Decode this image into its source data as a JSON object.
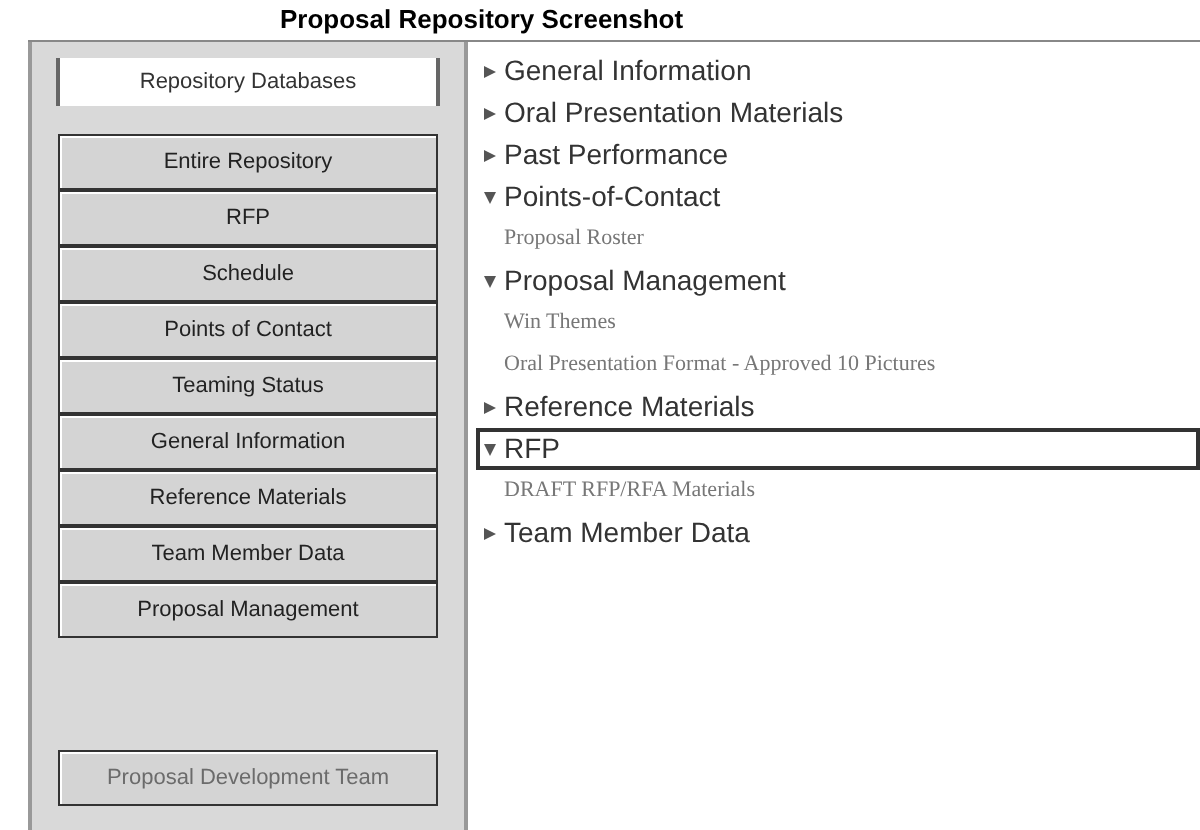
{
  "window": {
    "title": "Proposal Repository Screenshot"
  },
  "sidebar": {
    "header": "Repository Databases",
    "buttons": [
      {
        "label": "Entire Repository",
        "disabled": false
      },
      {
        "label": "RFP",
        "disabled": false
      },
      {
        "label": "Schedule",
        "disabled": false
      },
      {
        "label": "Points of Contact",
        "disabled": false
      },
      {
        "label": "Teaming Status",
        "disabled": false
      },
      {
        "label": "General Information",
        "disabled": false
      },
      {
        "label": "Reference Materials",
        "disabled": false
      },
      {
        "label": "Team Member Data",
        "disabled": false
      },
      {
        "label": "Proposal Management",
        "disabled": false
      }
    ],
    "footer_button": {
      "label": "Proposal Development Team",
      "disabled": true
    }
  },
  "tree": [
    {
      "label": "General Information",
      "expanded": false,
      "selected": false
    },
    {
      "label": "Oral Presentation Materials",
      "expanded": false,
      "selected": false
    },
    {
      "label": "Past Performance",
      "expanded": false,
      "selected": false
    },
    {
      "label": "Points-of-Contact",
      "expanded": true,
      "selected": false,
      "children": [
        {
          "label": "Proposal Roster"
        }
      ]
    },
    {
      "label": "Proposal Management",
      "expanded": true,
      "selected": false,
      "children": [
        {
          "label": "Win Themes"
        },
        {
          "label": "Oral Presentation Format - Approved 10 Pictures"
        }
      ]
    },
    {
      "label": "Reference Materials",
      "expanded": false,
      "selected": false
    },
    {
      "label": "RFP",
      "expanded": true,
      "selected": true,
      "children": [
        {
          "label": "DRAFT RFP/RFA Materials"
        }
      ]
    },
    {
      "label": "Team Member Data",
      "expanded": false,
      "selected": false
    }
  ]
}
